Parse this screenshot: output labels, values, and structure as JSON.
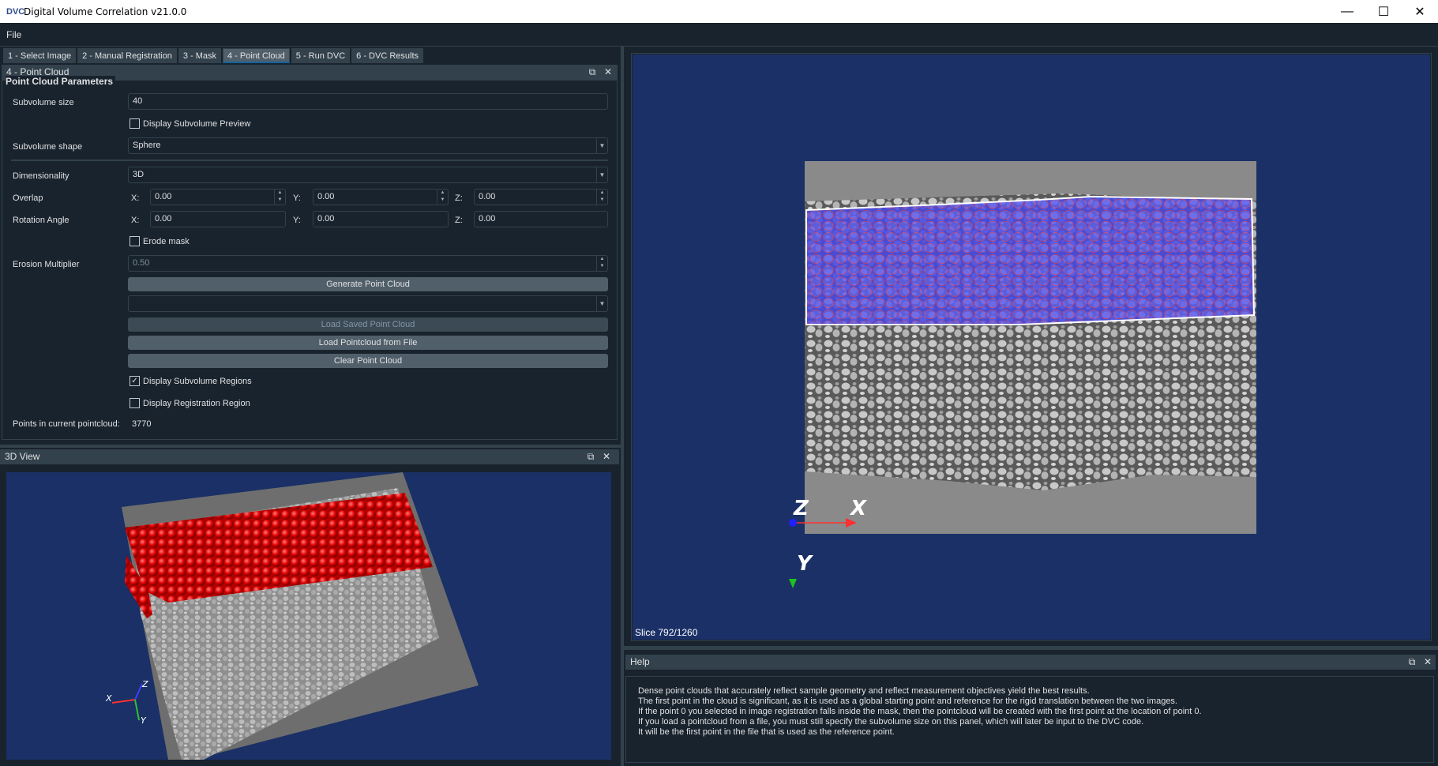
{
  "window": {
    "title": "Digital Volume Correlation v21.0.0",
    "app_icon": "DVC"
  },
  "menu": {
    "file": "File"
  },
  "tabs": [
    {
      "label": "1 - Select Image",
      "active": false
    },
    {
      "label": "2 - Manual Registration",
      "active": false
    },
    {
      "label": "3 - Mask",
      "active": false
    },
    {
      "label": "4 - Point Cloud",
      "active": true
    },
    {
      "label": "5 - Run DVC",
      "active": false
    },
    {
      "label": "6 - DVC Results",
      "active": false
    }
  ],
  "point_cloud_panel": {
    "title": "4 - Point Cloud",
    "group_title": "Point Cloud Parameters",
    "subvolume_size_label": "Subvolume size",
    "subvolume_size_value": "40",
    "display_subvolume_preview": {
      "label": "Display Subvolume Preview",
      "checked": false
    },
    "subvolume_shape_label": "Subvolume shape",
    "subvolume_shape_value": "Sphere",
    "dimensionality_label": "Dimensionality",
    "dimensionality_value": "3D",
    "overlap_label": "Overlap",
    "overlap": {
      "x_label": "X:",
      "x": "0.00",
      "y_label": "Y:",
      "y": "0.00",
      "z_label": "Z:",
      "z": "0.00"
    },
    "rotation_label": "Rotation Angle",
    "rotation": {
      "x_label": "X:",
      "x": "0.00",
      "y_label": "Y:",
      "y": "0.00",
      "z_label": "Z:",
      "z": "0.00"
    },
    "erode_mask": {
      "label": "Erode mask",
      "checked": false
    },
    "erosion_label": "Erosion Multiplier",
    "erosion_value": "0.50",
    "generate_button": "Generate Point Cloud",
    "pointcloud_combo_value": "",
    "load_saved_button": "Load Saved Point Cloud",
    "load_file_button": "Load Pointcloud from File",
    "clear_button": "Clear Point Cloud",
    "display_subvolume_regions": {
      "label": "Display Subvolume Regions",
      "checked": true
    },
    "display_registration_region": {
      "label": "Display Registration Region",
      "checked": false
    },
    "points_label": "Points in current pointcloud:",
    "points_value": "3770"
  },
  "view3d_panel": {
    "title": "3D View",
    "axes": {
      "x": "X",
      "y": "Y",
      "z": "Z"
    }
  },
  "viewer2d": {
    "slice_label": "Slice 792/1260",
    "axes": {
      "x": "X",
      "y": "Y",
      "z": "Z"
    }
  },
  "help_panel": {
    "title": "Help",
    "lines": [
      "Dense point clouds that accurately reflect sample geometry and reflect measurement objectives yield the best results.",
      "The first point in the cloud is significant, as it is used as a global starting point and reference for the rigid translation between the two images.",
      "If the point 0 you selected in image registration falls inside the mask, then the pointcloud will be created with the first point at the location of point 0.",
      "If you load a pointcloud from a file, you must still specify the subvolume size on this panel, which will later be input to the DVC code.",
      "It will be the first point in the file that is used as the reference point."
    ]
  },
  "colors": {
    "background": "#19232d",
    "panel_header": "#32414b",
    "button": "#505f69",
    "viewer_background": "#1a3066",
    "point_marker": "#e00000",
    "mask_overlay": "#3c3cff"
  },
  "icons": [
    "minimize-icon",
    "maximize-icon",
    "close-icon",
    "float-icon",
    "checkmark-icon"
  ]
}
